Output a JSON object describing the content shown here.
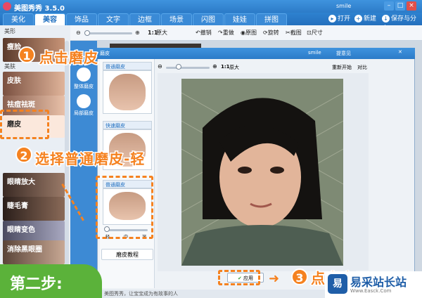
{
  "app": {
    "title": "美图秀秀 3.5.0",
    "user": "smile",
    "min": "–",
    "max": "□",
    "close": "×"
  },
  "tabs": [
    "美化",
    "美容",
    "饰品",
    "文字",
    "边框",
    "场景",
    "闪图",
    "娃娃",
    "拼图"
  ],
  "top_actions": {
    "open": "打开",
    "new": "新建",
    "save": "保存与分享"
  },
  "toolbar": {
    "zoom_ratio": "1:1",
    "original_size": "原大",
    "undo": "撤销",
    "redo": "重做",
    "original": "原图",
    "rotate": "旋转",
    "crop": "截图",
    "size": "尺寸"
  },
  "left_list": {
    "section_shape": "美形",
    "section_skin": "美肤",
    "items": [
      {
        "label": "瘦脸"
      },
      {
        "label": "皮肤"
      },
      {
        "label": "祛痘祛斑"
      },
      {
        "label": "磨皮"
      },
      {
        "label": "眼睛放大"
      },
      {
        "label": "睫毛膏"
      },
      {
        "label": "眼睛变色"
      },
      {
        "label": "消除黑眼圈"
      }
    ]
  },
  "side_buttons": [
    "整体磨皮",
    "局部磨皮"
  ],
  "dialog": {
    "title": "磨皮",
    "user": "smile",
    "feedback": "提意见",
    "zoom_ratio": "1:1",
    "original_size": "原大",
    "restart": "重新开始",
    "compare": "对比",
    "presets": [
      {
        "label": "普通磨皮"
      },
      {
        "label": "快速磨皮"
      },
      {
        "label": "普通磨皮"
      }
    ],
    "levels": [
      "轻",
      "中",
      "深"
    ],
    "tutorial": "磨皮教程",
    "apply": "应用"
  },
  "annotations": {
    "step1_num": "1",
    "step1_text": "点击磨皮",
    "step2_num": "2",
    "step2_text": "选择普通磨皮-轻",
    "step3_num": "3",
    "step3_text": "点击应用",
    "step_banner": "第二步:"
  },
  "status": "美图秀秀，让宝宝成为有故事的人",
  "watermark": {
    "mark": "易",
    "name": "易采站长站",
    "url": "Www.Easck.Com"
  }
}
